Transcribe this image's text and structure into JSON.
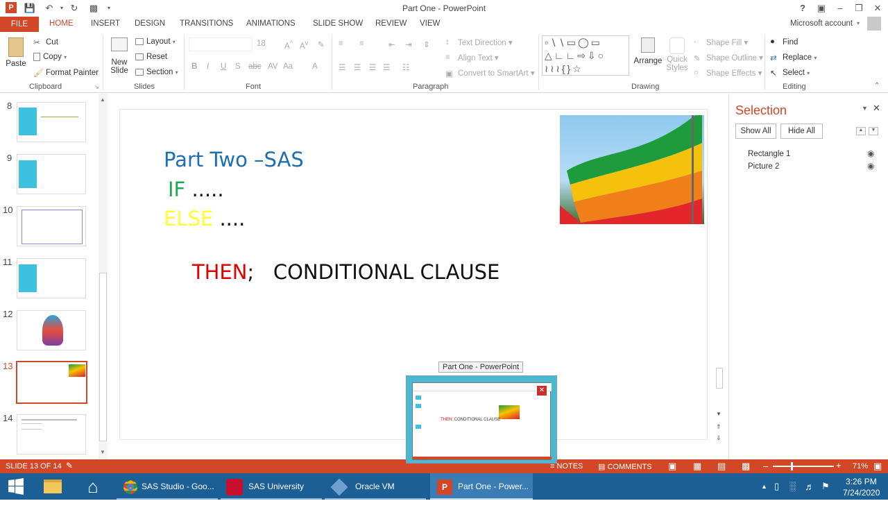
{
  "window": {
    "title": "Part One - PowerPoint"
  },
  "tabs": [
    "FILE",
    "HOME",
    "INSERT",
    "DESIGN",
    "TRANSITIONS",
    "ANIMATIONS",
    "SLIDE SHOW",
    "REVIEW",
    "VIEW"
  ],
  "account": "Microsoft account",
  "ribbon": {
    "clipboard": {
      "paste": "Paste",
      "cut": "Cut",
      "copy": "Copy",
      "format_painter": "Format Painter",
      "label": "Clipboard"
    },
    "slides": {
      "new_slide_1": "New",
      "new_slide_2": "Slide",
      "layout": "Layout",
      "reset": "Reset",
      "section": "Section",
      "label": "Slides"
    },
    "font": {
      "size": "18",
      "bold": "B",
      "italic": "I",
      "underline": "U",
      "strike": "S",
      "label": "Font"
    },
    "paragraph": {
      "text_direction": "Text Direction",
      "align_text": "Align Text",
      "convert": "Convert to SmartArt",
      "label": "Paragraph"
    },
    "drawing": {
      "arrange": "Arrange",
      "quick_1": "Quick",
      "quick_2": "Styles",
      "shape_fill": "Shape Fill",
      "shape_outline": "Shape Outline",
      "shape_effects": "Shape Effects",
      "label": "Drawing"
    },
    "editing": {
      "find": "Find",
      "replace": "Replace",
      "select": "Select",
      "label": "Editing"
    }
  },
  "thumbnails": [
    "8",
    "9",
    "10",
    "11",
    "12",
    "13",
    "14"
  ],
  "slide": {
    "line1": "Part Two –SAS",
    "if": "IF",
    "if_dots": ".....",
    "else": "ELSE",
    "else_dots": "....",
    "then": "THEN",
    "then_rest": ";   CONDITIONAL CLAUSE"
  },
  "selection_pane": {
    "title": "Selection",
    "show_all": "Show All",
    "hide_all": "Hide All",
    "items": [
      "Rectangle 1",
      "Picture 2"
    ]
  },
  "preview": {
    "title": "Part One - PowerPoint"
  },
  "status": {
    "slide": "SLIDE 13 OF 14",
    "notes": "NOTES",
    "comments": "COMMENTS",
    "zoom": "71%"
  },
  "taskbar": {
    "items": [
      "SAS Studio - Goo...",
      "SAS University Edi...",
      "Oracle VM Virtual...",
      "Part One - Power..."
    ],
    "time": "3:26 PM",
    "date": "7/24/2020"
  },
  "colors": {
    "accent": "#d24726",
    "title_blue": "#1f6fb0",
    "if_green": "#1fa84f",
    "else_yellow": "#ffff33",
    "then_red": "#e00000"
  }
}
